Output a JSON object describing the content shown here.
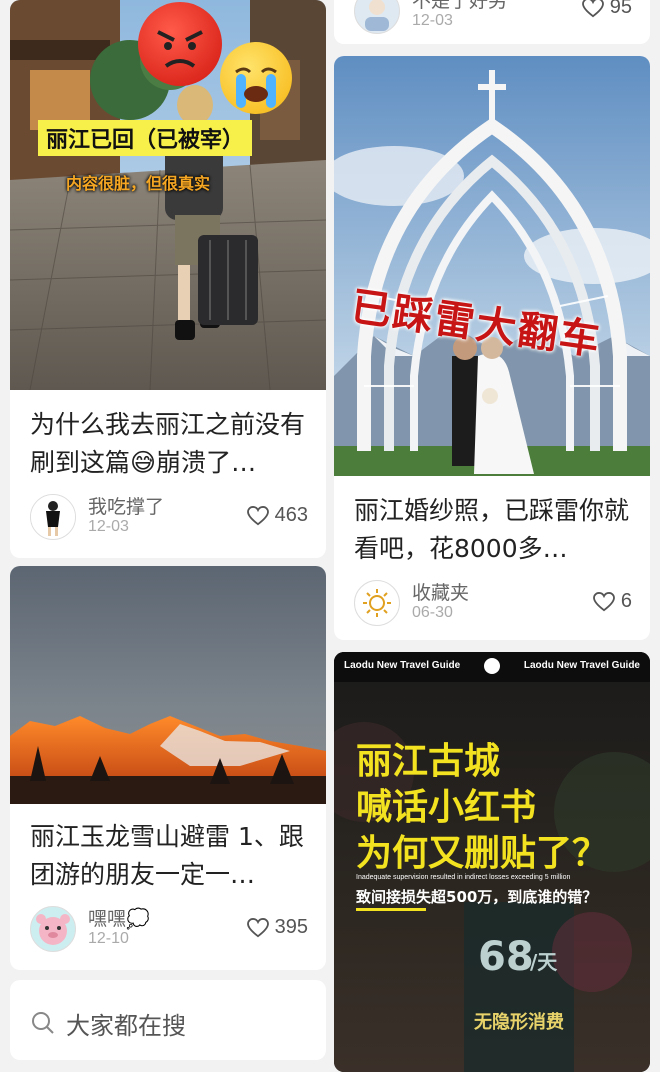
{
  "cards": [
    {
      "title": "为什么我去丽江之前没有刷到这篇😅崩溃了…",
      "user": "我吃撑了",
      "date": "12-03",
      "likes": "463",
      "overlay_main": "丽江已回（已被宰）",
      "overlay_sub": "内容很脏，但很真实"
    },
    {
      "title": "丽江玉龙雪山避雷 1、跟团游的朋友一定一…",
      "user": "嘿嘿💭",
      "date": "12-10",
      "likes": "395"
    },
    {
      "user": "不是了好另",
      "date": "12-03",
      "likes": "95"
    },
    {
      "title": "丽江婚纱照，已踩雷你就看吧，花8000多…",
      "user": "收藏夹",
      "date": "06-30",
      "likes": "6",
      "overlay_main": "已踩雷大翻车"
    },
    {
      "header_left": "Laodu New Travel Guide",
      "header_right": "Laodu New Travel Guide",
      "big_line1": "丽江古城",
      "big_line2": "喊话小红书",
      "big_line3": "为何又删贴了？",
      "english_line": "Inadequate supervision resulted in indirect losses exceeding 5 million",
      "cn_line": "致间接损失超500万，到底谁的错？",
      "sign_price": "68",
      "sign_unit": "/天",
      "sign_text": "无隐形消费"
    }
  ],
  "search": {
    "label": "大家都在搜"
  }
}
